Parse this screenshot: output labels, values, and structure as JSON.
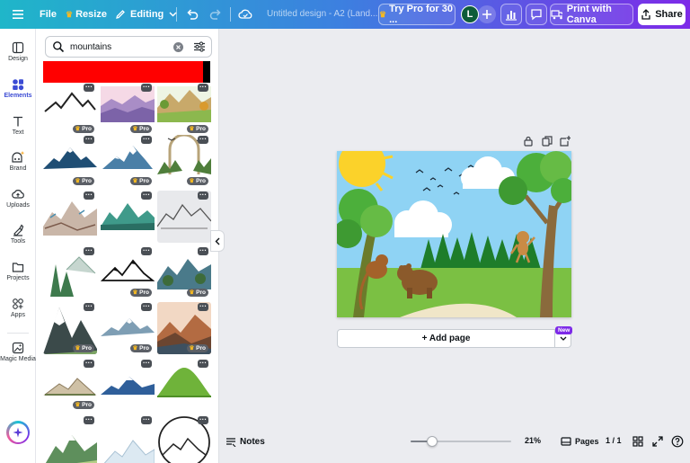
{
  "topbar": {
    "file_label": "File",
    "resize_label": "Resize",
    "editing_label": "Editing",
    "doc_title": "Untitled design - A2 (Land...",
    "try_pro_label": "Try Pro for 30 ...",
    "avatar_letter": "L",
    "print_label": "Print with Canva",
    "share_label": "Share"
  },
  "rail": {
    "items": [
      {
        "label": "Design",
        "icon": "design-icon"
      },
      {
        "label": "Elements",
        "icon": "elements-icon"
      },
      {
        "label": "Text",
        "icon": "text-icon"
      },
      {
        "label": "Brand",
        "icon": "brand-icon"
      },
      {
        "label": "Uploads",
        "icon": "uploads-icon"
      },
      {
        "label": "Tools",
        "icon": "tools-icon"
      },
      {
        "label": "Projects",
        "icon": "projects-icon"
      },
      {
        "label": "Apps",
        "icon": "apps-icon"
      },
      {
        "label": "Magic Media",
        "icon": "magic-media-icon"
      }
    ]
  },
  "search": {
    "value": "mountains"
  },
  "grid": {
    "pro_label": "Pro",
    "more_label": "···"
  },
  "canvas": {
    "add_page_label": "+ Add page",
    "new_badge": "New"
  },
  "bottombar": {
    "notes_label": "Notes",
    "zoom_label": "21%",
    "zoom_level": 0.21,
    "pages_label": "Pages",
    "page_counter": "1 / 1"
  },
  "colors": {
    "accent": "#7d2ae8",
    "brand_gradient_start": "#1fb6c9",
    "brand_gradient_end": "#7d2ae8",
    "banner": "#ff0000"
  }
}
